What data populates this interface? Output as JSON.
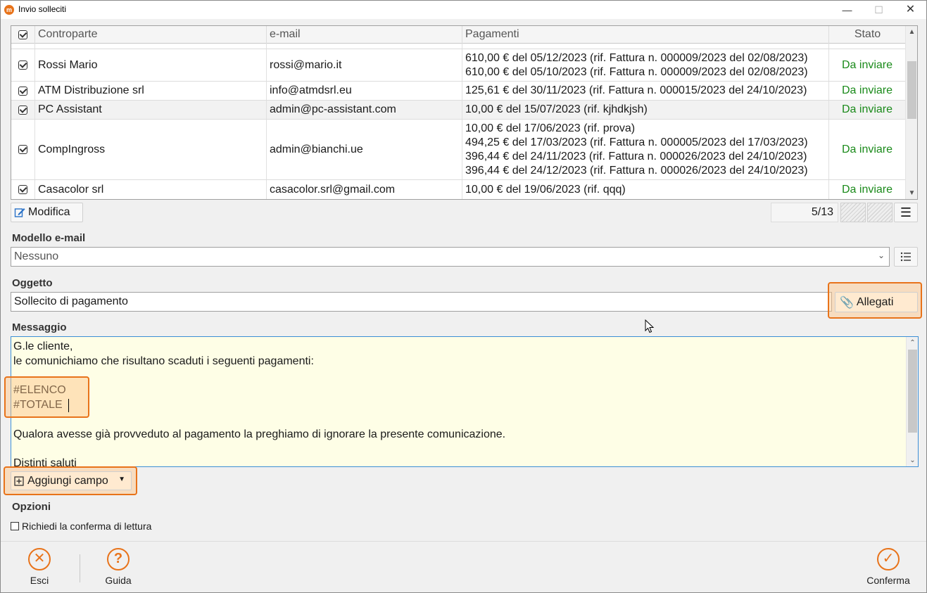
{
  "window": {
    "title": "Invio solleciti",
    "app_icon_letter": "m"
  },
  "grid": {
    "headers": {
      "controparte": "Controparte",
      "email": "e-mail",
      "pagamenti": "Pagamenti",
      "stato": "Stato"
    },
    "rows": [
      {
        "controparte": "Rossi Mario",
        "email": "rossi@mario.it",
        "pagamenti": [
          "610,00 € del 05/12/2023 (rif. Fattura n. 000009/2023 del 02/08/2023)",
          "610,00 € del 05/10/2023 (rif. Fattura n. 000009/2023 del 02/08/2023)"
        ],
        "stato": "Da inviare"
      },
      {
        "controparte": "ATM Distribuzione srl",
        "email": "info@atmdsrl.eu",
        "pagamenti": [
          "125,61 € del 30/11/2023 (rif. Fattura n. 000015/2023 del 24/10/2023)"
        ],
        "stato": "Da inviare"
      },
      {
        "controparte": "PC Assistant",
        "email": "admin@pc-assistant.com",
        "pagamenti": [
          "10,00 € del 15/07/2023 (rif. kjhdkjsh)"
        ],
        "stato": "Da inviare"
      },
      {
        "controparte": "CompIngross",
        "email": "admin@bianchi.ue",
        "pagamenti": [
          "10,00 € del 17/06/2023 (rif. prova)",
          "494,25 € del 17/03/2023 (rif. Fattura n. 000005/2023 del 17/03/2023)",
          "396,44 € del 24/11/2023 (rif. Fattura n. 000026/2023 del 24/10/2023)",
          "396,44 € del 24/12/2023 (rif. Fattura n. 000026/2023 del 24/10/2023)"
        ],
        "stato": "Da inviare"
      },
      {
        "controparte": "Casacolor srl",
        "email": "casacolor.srl@gmail.com",
        "pagamenti": [
          "10,00 € del 19/06/2023 (rif. qqq)"
        ],
        "stato": "Da inviare"
      }
    ],
    "counter": "5/13",
    "stato_color": "#1a8a1a"
  },
  "toolbar": {
    "modifica_label": "Modifica"
  },
  "modello": {
    "label": "Modello e-mail",
    "value": "Nessuno"
  },
  "oggetto": {
    "label": "Oggetto",
    "value": "Sollecito di pagamento",
    "allegati_label": "Allegati"
  },
  "messaggio": {
    "label": "Messaggio",
    "text": "G.le cliente,\nle comunichiamo che risultano scaduti i seguenti pagamenti:\n\n#ELENCO\n#TOTALE\n\nQualora avesse già provveduto al pagamento la preghiamo di ignorare la presente comunicazione.\n\nDistinti saluti"
  },
  "aggiungi_campo": {
    "label": "Aggiungi campo"
  },
  "opzioni": {
    "label": "Opzioni",
    "conferma_lettura": "Richiedi la conferma di lettura"
  },
  "footer": {
    "esci": "Esci",
    "guida": "Guida",
    "conferma": "Conferma"
  },
  "colors": {
    "accent": "#e8731a",
    "highlight": "#ffc482",
    "message_bg": "#fefee6"
  }
}
